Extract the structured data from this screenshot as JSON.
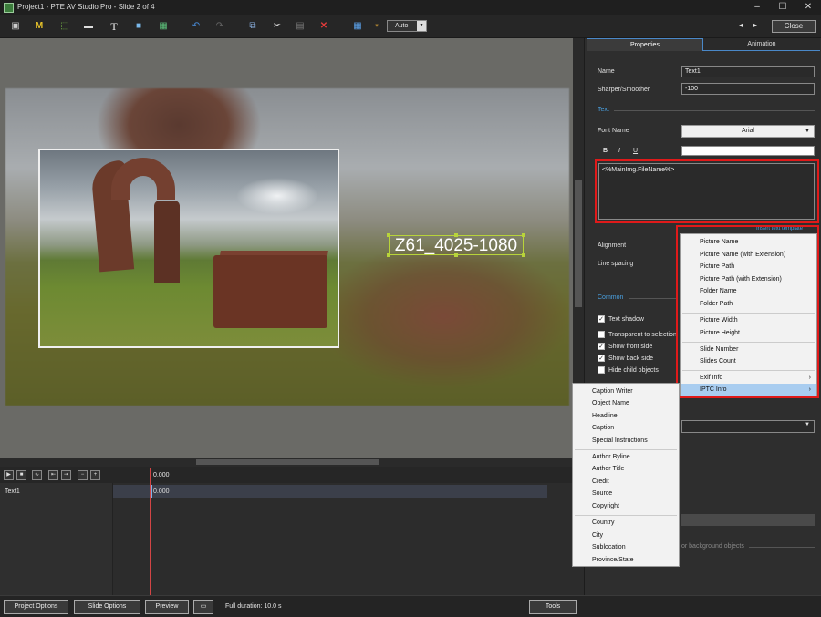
{
  "window": {
    "title": "Project1 - PTE AV Studio Pro - Slide 2 of 4",
    "controls": [
      "–",
      "☐",
      "✕"
    ]
  },
  "toolbar": {
    "icons": [
      "camera-icon",
      "m-icon",
      "frame-icon",
      "text-card-icon",
      "text-icon",
      "rectangle-icon",
      "image-icon",
      "undo-icon",
      "redo-icon",
      "copy-icon",
      "cut-icon",
      "paste-icon",
      "delete-icon",
      "grid-icon",
      "pin-icon"
    ],
    "m_glyph": "M",
    "t_glyph": "T",
    "zoom_value": "Auto",
    "nav_prev": "◂",
    "nav_next": "▸",
    "close_label": "Close"
  },
  "canvas": {
    "text_object": "Z61_4025-1080"
  },
  "timeline": {
    "start_time": "0.000",
    "track_name": "Text1",
    "track_time": "0.000",
    "buttons": [
      "▶",
      "■",
      "∿",
      "⇤",
      "⇥",
      "−",
      "+"
    ]
  },
  "bottom": {
    "project_options": "Project Options",
    "slide_options": "Slide Options",
    "preview": "Preview",
    "duration": "Full duration: 10.0 s",
    "tools": "Tools"
  },
  "panel": {
    "tabs": [
      "Properties",
      "Animation"
    ],
    "name_label": "Name",
    "name_value": "Text1",
    "sharper_label": "Sharper/Smoother",
    "sharper_value": "-100",
    "text_section": "Text",
    "font_label": "Font Name",
    "font_value": "Arial",
    "bold": "B",
    "italic": "I",
    "underline": "U",
    "text_content": "<%MainImg.FileName%>",
    "insert_template": "Insert text template",
    "alignment_label": "Alignment",
    "line_spacing_label": "Line spacing",
    "common_section": "Common",
    "checkboxes": [
      {
        "label": "Text shadow",
        "checked": true
      },
      {
        "label": "Transparent to selection",
        "checked": false
      },
      {
        "label": "Show front side",
        "checked": true
      },
      {
        "label": "Show back side",
        "checked": true
      },
      {
        "label": "Hide child objects",
        "checked": false
      }
    ],
    "bg_objects_text": "or background objects"
  },
  "template_menu": {
    "items": [
      {
        "label": "Picture Name"
      },
      {
        "label": "Picture Name (with Extension)"
      },
      {
        "label": "Picture Path"
      },
      {
        "label": "Picture Path (with Extension)"
      },
      {
        "label": "Folder Name"
      },
      {
        "label": "Folder Path"
      },
      {
        "label": "Picture Width"
      },
      {
        "label": "Picture Height"
      },
      {
        "label": "Slide Number"
      },
      {
        "label": "Slides Count"
      },
      {
        "label": "Exif Info",
        "submenu": "›"
      },
      {
        "label": "IPTC Info",
        "submenu": "›"
      }
    ],
    "highlighted": "IPTC Info"
  },
  "iptc_menu": {
    "items": [
      "Caption Writer",
      "Object Name",
      "Headline",
      "Caption",
      "Special Instructions",
      "Author Byline",
      "Author Title",
      "Credit",
      "Source",
      "Copyright",
      "Country",
      "City",
      "Sublocation",
      "Province/State"
    ]
  },
  "colors": {
    "accent_blue": "#4aa0e0",
    "highlight_red": "#e01a1a",
    "selection_green": "#b8d43a",
    "menu_highlight": "#a9cdf0"
  }
}
